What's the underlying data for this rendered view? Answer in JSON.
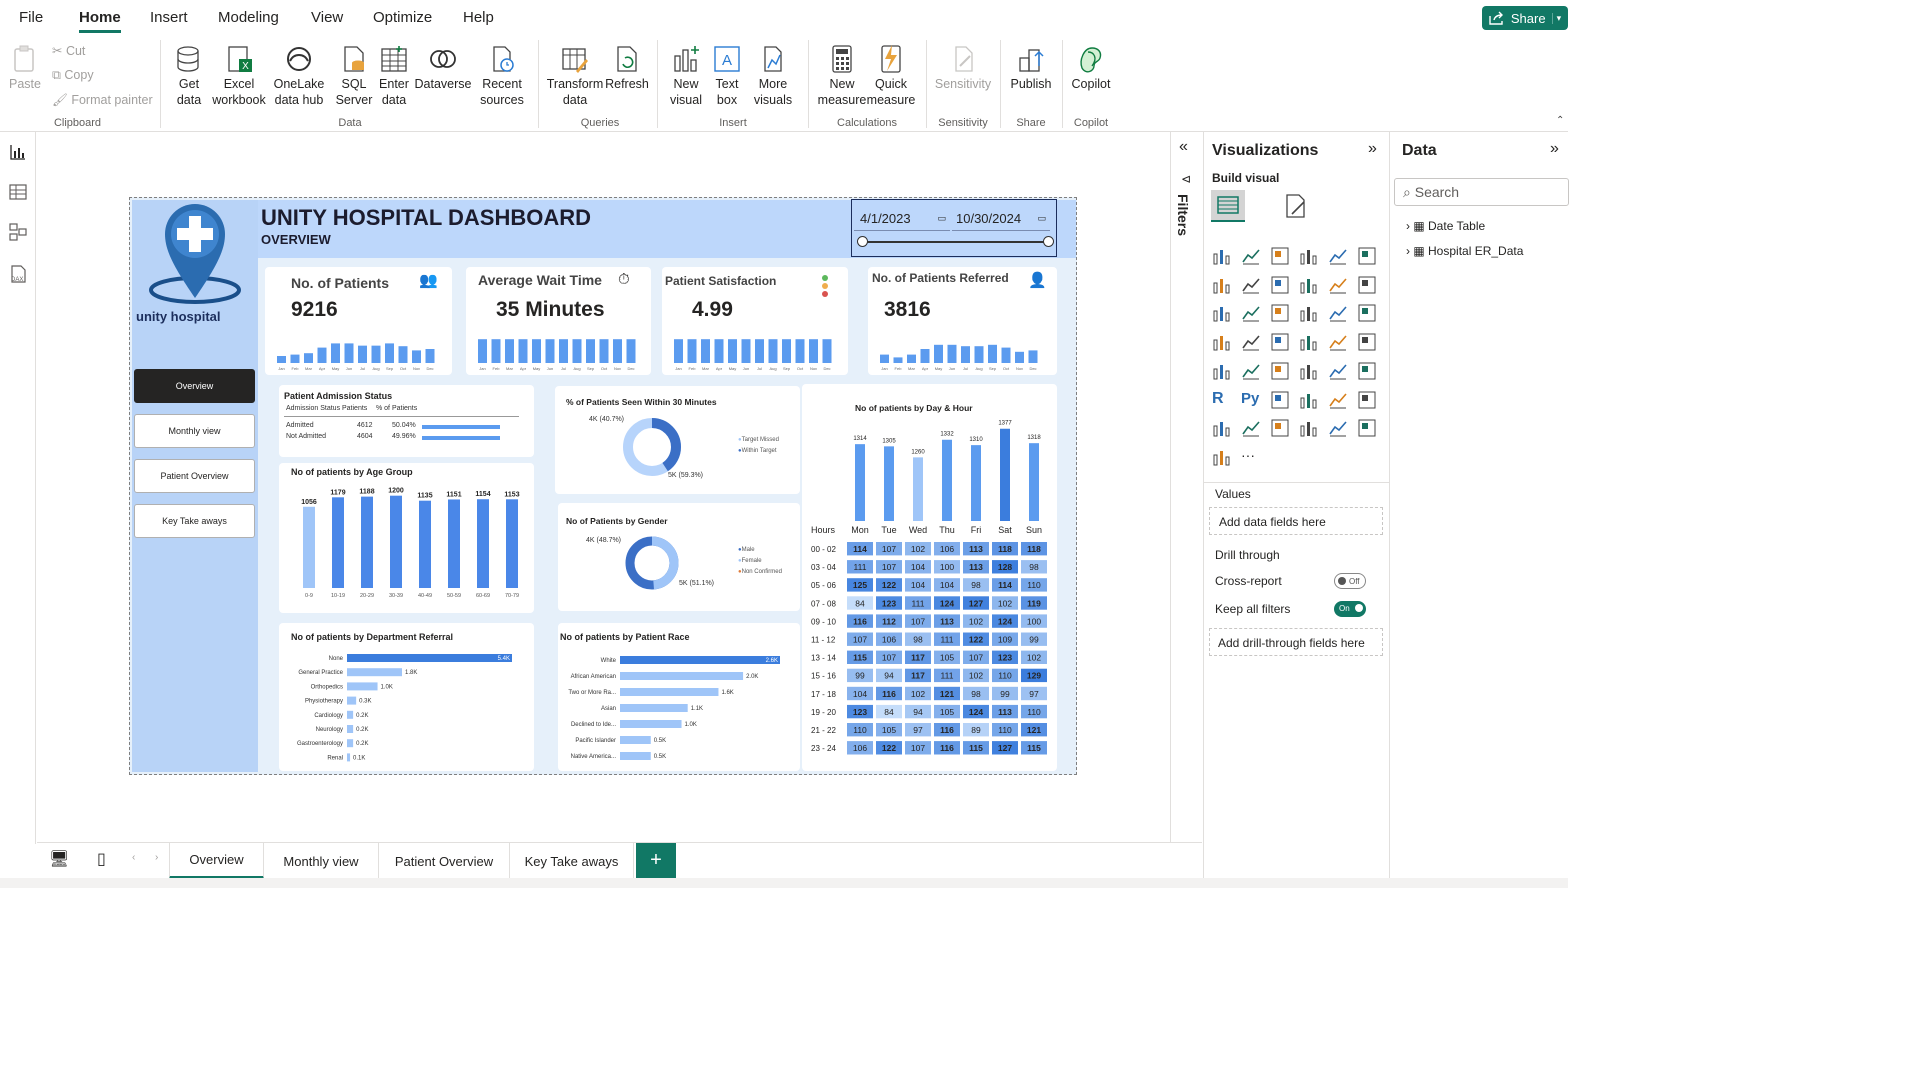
{
  "menubar": {
    "items": [
      "File",
      "Home",
      "Insert",
      "Modeling",
      "View",
      "Optimize",
      "Help"
    ],
    "share_label": "Share"
  },
  "ribbon": {
    "clipboard": {
      "paste": "Paste",
      "cut": "Cut",
      "copy": "Copy",
      "format_painter": "Format painter",
      "group": "Clipboard"
    },
    "data": {
      "get_data": "Get data",
      "excel": "Excel workbook",
      "onelake": "OneLake data hub",
      "sql": "SQL Server",
      "enter": "Enter data",
      "dataverse": "Dataverse",
      "recent": "Recent sources",
      "group": "Data"
    },
    "queries": {
      "transform": "Transform data",
      "refresh": "Refresh",
      "group": "Queries"
    },
    "insert": {
      "new_visual": "New visual",
      "text_box": "Text box",
      "more_visuals": "More visuals",
      "group": "Insert"
    },
    "calculations": {
      "new_measure": "New measure",
      "quick_measure": "Quick measure",
      "group": "Calculations"
    },
    "sensitivity": {
      "label": "Sensitivity",
      "group": "Sensitivity"
    },
    "share": {
      "publish": "Publish",
      "group": "Share"
    },
    "copilot": {
      "label": "Copilot",
      "group": "Copilot"
    }
  },
  "report": {
    "title": "UNITY HOSPITAL DASHBOARD",
    "subtitle": "OVERVIEW",
    "logo_text": "unity hospital",
    "date_start": "4/1/2023",
    "date_end": "10/30/2024",
    "nav": [
      "Overview",
      "Monthly view",
      "Patient Overview",
      "Key Take aways"
    ],
    "months": [
      "Jan",
      "Feb",
      "Mar",
      "Apr",
      "May",
      "Jun",
      "Jul",
      "Aug",
      "Sep",
      "Oct",
      "Nov",
      "Dec"
    ],
    "kpis": [
      {
        "title": "No. of Patients",
        "value": "9216",
        "bars": [
          0.25,
          0.3,
          0.35,
          0.55,
          0.7,
          0.7,
          0.62,
          0.62,
          0.7,
          0.6,
          0.45,
          0.5
        ]
      },
      {
        "title": "Average Wait Time",
        "value": "35 Minutes",
        "bars": [
          0.85,
          0.85,
          0.85,
          0.85,
          0.85,
          0.85,
          0.85,
          0.85,
          0.85,
          0.85,
          0.85,
          0.85
        ]
      },
      {
        "title": "Patient Satisfaction",
        "value": "4.99",
        "bars": [
          0.85,
          0.85,
          0.85,
          0.85,
          0.85,
          0.85,
          0.85,
          0.85,
          0.85,
          0.85,
          0.85,
          0.85
        ]
      },
      {
        "title": "No. of Patients Referred",
        "value": "3816",
        "bars": [
          0.3,
          0.2,
          0.3,
          0.5,
          0.65,
          0.65,
          0.6,
          0.6,
          0.65,
          0.55,
          0.4,
          0.45
        ]
      }
    ],
    "admission": {
      "title": "Patient Admission Status",
      "headers": [
        "Admission Status",
        "Patients",
        "% of Patients"
      ],
      "rows": [
        {
          "status": "Admitted",
          "patients": "4612",
          "pct": "50.04%",
          "frac": 0.5004
        },
        {
          "status": "Not Admitted",
          "patients": "4604",
          "pct": "49.96%",
          "frac": 0.4996
        }
      ]
    },
    "seen30": {
      "title": "% of Patients Seen Within 30 Minutes",
      "a": "4K (40.7%)",
      "b": "5K (59.3%)",
      "legend": [
        "Target Missed",
        "Within Target"
      ],
      "frac": 0.407
    },
    "gender": {
      "title": "No of Patients by Gender",
      "a": "4K (48.7%)",
      "b": "5K (51.1%)",
      "legend": [
        "Male",
        "Female",
        "Non Confirmed"
      ],
      "frac": 0.487
    },
    "age": {
      "title": "No of patients by Age Group",
      "categories": [
        "0-9",
        "10-19",
        "20-29",
        "30-39",
        "40-49",
        "50-59",
        "60-69",
        "70-79"
      ],
      "values": [
        1056,
        1179,
        1188,
        1200,
        1135,
        1151,
        1154,
        1153
      ]
    },
    "dept": {
      "title": "No of patients by Department Referral",
      "categories": [
        "None",
        "General Practice",
        "Orthopedics",
        "Physiotherapy",
        "Cardiology",
        "Neurology",
        "Gastroenterology",
        "Renal"
      ],
      "labels": [
        "5.4K",
        "1.8K",
        "1.0K",
        "0.3K",
        "0.2K",
        "0.2K",
        "0.2K",
        "0.1K"
      ],
      "values": [
        5400,
        1800,
        1000,
        300,
        200,
        200,
        200,
        100
      ]
    },
    "race": {
      "title": "No of patients by Patient Race",
      "categories": [
        "White",
        "African American",
        "Two or More Ra...",
        "Asian",
        "Declined to Ide...",
        "Pacific Islander",
        "Native America..."
      ],
      "labels": [
        "2.6K",
        "2.0K",
        "1.6K",
        "1.1K",
        "1.0K",
        "0.5K",
        "0.5K"
      ],
      "values": [
        2600,
        2000,
        1600,
        1100,
        1000,
        500,
        500
      ]
    },
    "dayhour": {
      "title": "No of patients by Day & Hour",
      "days": [
        "Mon",
        "Tue",
        "Wed",
        "Thu",
        "Fri",
        "Sat",
        "Sun"
      ],
      "totals": [
        1314,
        1305,
        1260,
        1332,
        1310,
        1377,
        1318
      ],
      "hours_label": "Hours",
      "hours": [
        "00 - 02",
        "03 - 04",
        "05 - 06",
        "07 - 08",
        "09 - 10",
        "11 - 12",
        "13 - 14",
        "15 - 16",
        "17 - 18",
        "19 - 20",
        "21 - 22",
        "23 - 24"
      ],
      "grid": [
        [
          114,
          107,
          102,
          106,
          113,
          118,
          118
        ],
        [
          111,
          107,
          104,
          100,
          113,
          128,
          98
        ],
        [
          125,
          122,
          104,
          104,
          98,
          114,
          110
        ],
        [
          84,
          123,
          111,
          124,
          127,
          102,
          119
        ],
        [
          116,
          112,
          107,
          113,
          102,
          124,
          100
        ],
        [
          107,
          106,
          98,
          111,
          122,
          109,
          99
        ],
        [
          115,
          107,
          117,
          105,
          107,
          123,
          102
        ],
        [
          99,
          94,
          117,
          111,
          102,
          110,
          129
        ],
        [
          104,
          116,
          102,
          121,
          98,
          99,
          97
        ],
        [
          123,
          84,
          94,
          105,
          124,
          113,
          110
        ],
        [
          110,
          105,
          97,
          116,
          89,
          110,
          121
        ],
        [
          106,
          122,
          107,
          116,
          115,
          127,
          115
        ]
      ]
    }
  },
  "viz_pane": {
    "title": "Visualizations",
    "build": "Build visual",
    "values": "Values",
    "add_data": "Add data fields here",
    "drill": "Drill through",
    "cross": "Cross-report",
    "cross_state": "Off",
    "keep": "Keep all filters",
    "keep_state": "On",
    "add_drill": "Add drill-through fields here"
  },
  "filters_label": "Filters",
  "data_pane": {
    "title": "Data",
    "search_placeholder": "Search",
    "tables": [
      "Date Table",
      "Hospital ER_Data"
    ]
  },
  "tabs": [
    "Overview",
    "Monthly view",
    "Patient Overview",
    "Key Take aways"
  ],
  "colors": {
    "accent": "#117865",
    "bar": "#5b9bef",
    "bar_dark": "#3b7ddd",
    "bar_light": "#9fc5f8",
    "header_bg": "#bdd7fb",
    "nav_bg": "#b8d3f7"
  }
}
